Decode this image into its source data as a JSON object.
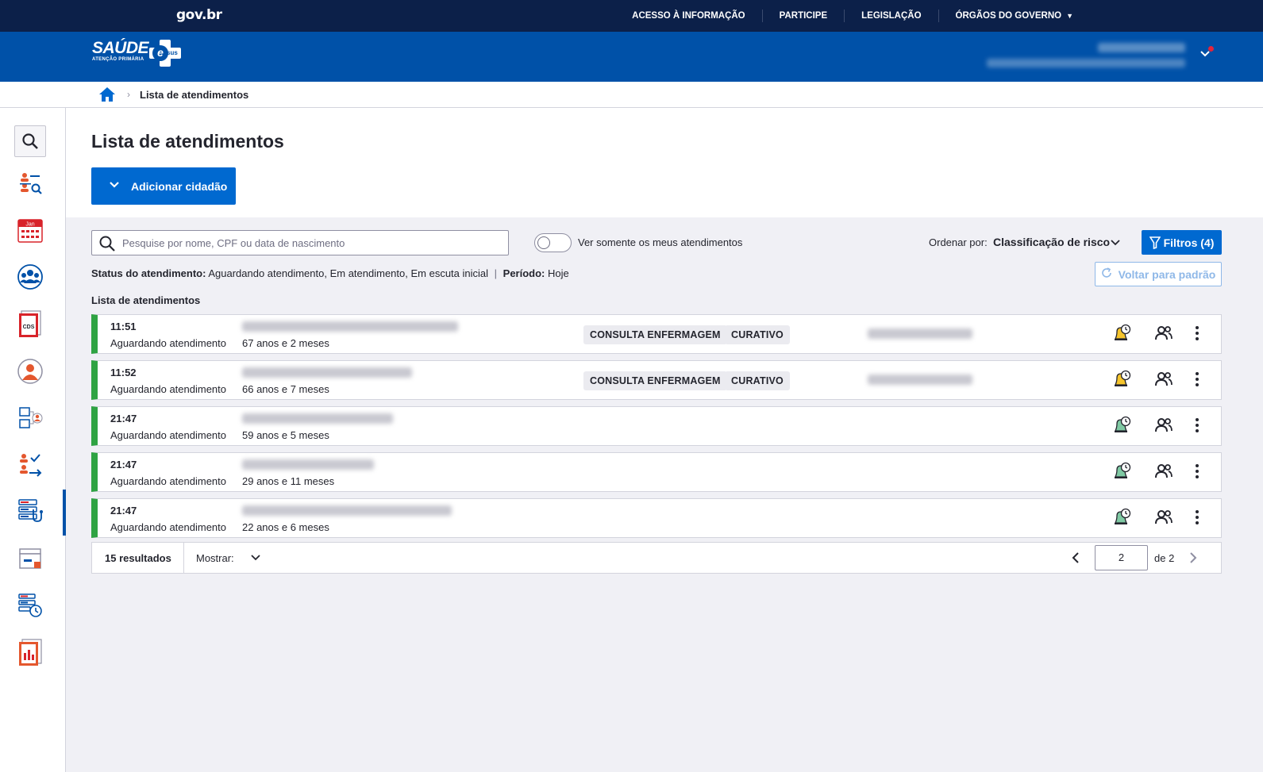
{
  "govbar": {
    "logo": "gov.br",
    "links": [
      "ACESSO À INFORMAÇÃO",
      "PARTICIPE",
      "LEGISLAÇÃO",
      "ÓRGÃOS DO GOVERNO"
    ]
  },
  "header": {
    "logo_title": "SAÚDE",
    "logo_subtitle": "ATENÇÃO PRIMÁRIA",
    "logo_badge": "sus"
  },
  "breadcrumb": {
    "current": "Lista de atendimentos"
  },
  "sidebar": {
    "items": [
      "search-icon",
      "citizen-search-icon",
      "calendar-icon",
      "groups-icon",
      "cds-icon",
      "person-icon",
      "flow-icon",
      "checklist-icon",
      "attendance-list-icon",
      "archive-icon",
      "queue-clock-icon",
      "report-icon"
    ],
    "calendar_label": "Jan",
    "cds_label": "CDS",
    "active": "attendance-list-icon"
  },
  "page": {
    "title": "Lista de atendimentos",
    "add_button": "Adicionar cidadão"
  },
  "toolbar": {
    "search_placeholder": "Pesquise por nome, CPF ou data de nascimento",
    "toggle_label": "Ver somente os meus atendimentos",
    "order_label": "Ordenar por:",
    "order_value": "Classificação de risco",
    "filter_button": "Filtros (4)",
    "reset_button": "Voltar para padrão"
  },
  "status_line": {
    "status_label": "Status do atendimento:",
    "status_value": "Aguardando atendimento, Em atendimento, Em escuta inicial",
    "separator": "|",
    "period_label": "Período:",
    "period_value": "Hoje"
  },
  "list": {
    "title": "Lista de atendimentos",
    "rows": [
      {
        "time": "11:51",
        "status": "Aguardando atendimento",
        "age": "67 anos e 2 meses",
        "tags": [
          "CONSULTA ENFERMAGEM",
          "CURATIVO"
        ]
      },
      {
        "time": "11:52",
        "status": "Aguardando atendimento",
        "age": "66 anos e 7 meses",
        "tags": [
          "CONSULTA ENFERMAGEM",
          "CURATIVO"
        ]
      },
      {
        "time": "21:47",
        "status": "Aguardando atendimento",
        "age": "59 anos e 5 meses",
        "tags": []
      },
      {
        "time": "21:47",
        "status": "Aguardando atendimento",
        "age": "29 anos e 11 meses",
        "tags": []
      },
      {
        "time": "21:47",
        "status": "Aguardando atendimento",
        "age": "22 anos e 6 meses",
        "tags": []
      }
    ]
  },
  "pager": {
    "results": "15 resultados",
    "show_label": "Mostrar:",
    "page": "2",
    "of": "de 2"
  },
  "colors": {
    "govbar": "#0c2049",
    "header": "#0051a8",
    "primary": "#0069d0",
    "row_status": "#2fa343",
    "background": "#f0f0f5"
  }
}
